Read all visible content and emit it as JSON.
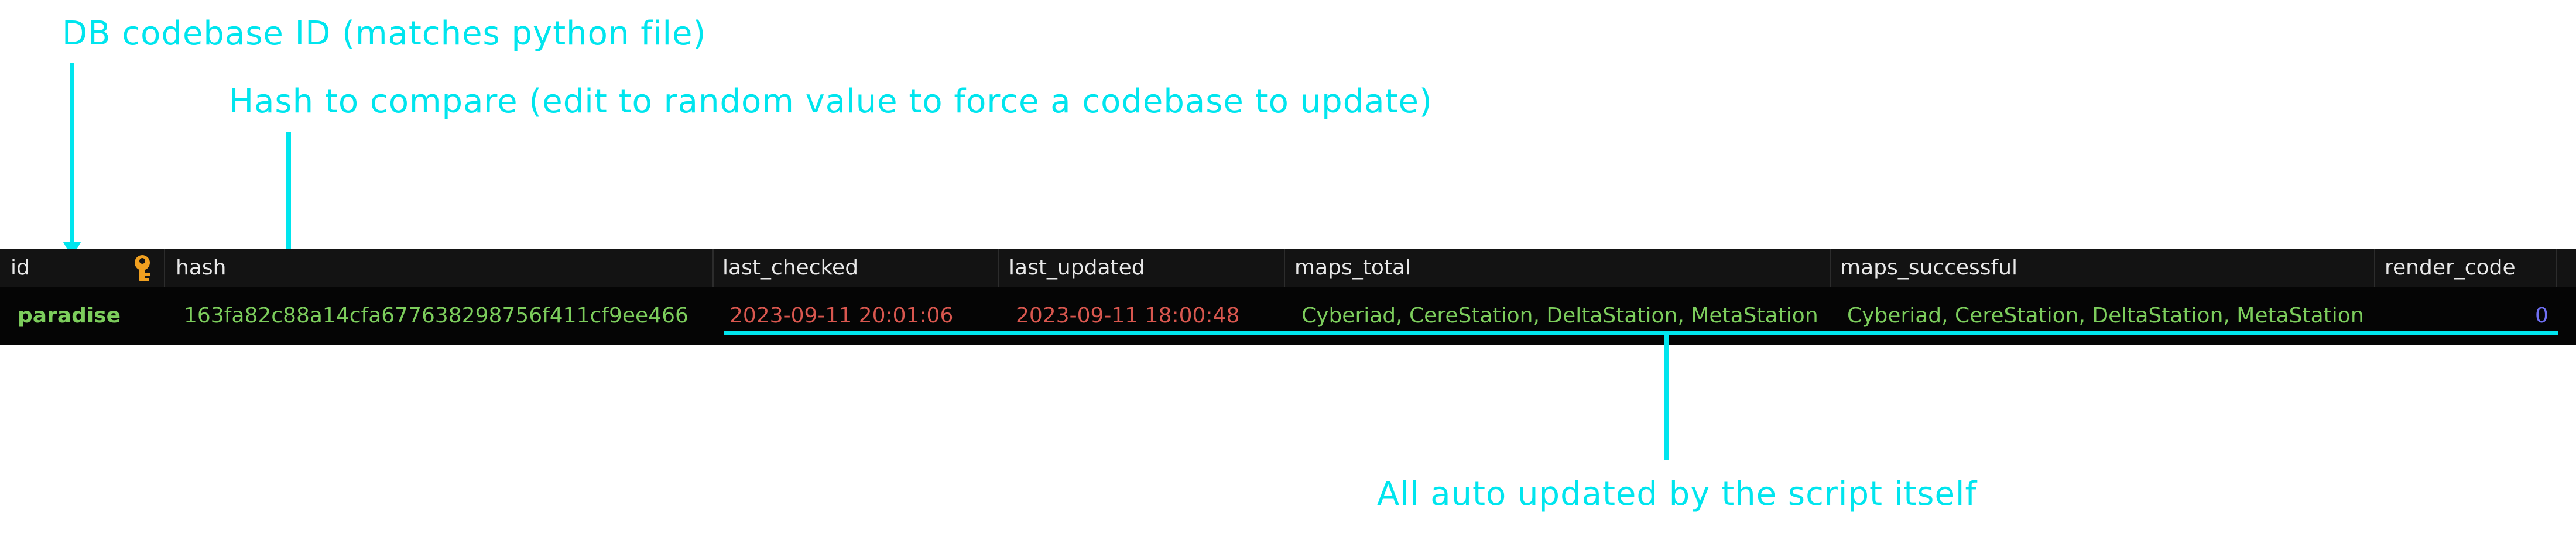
{
  "annotations": {
    "id_note": "DB codebase ID (matches python file)",
    "hash_note": "Hash to compare (edit to random value to force a codebase to update)",
    "auto_note": "All auto updated by the script itself"
  },
  "table": {
    "columns": [
      "id",
      "hash",
      "last_checked",
      "last_updated",
      "maps_total",
      "maps_successful",
      "render_code"
    ],
    "primary_key_icon": "key-icon",
    "rows": [
      {
        "id": "paradise",
        "hash": "163fa82c88a14cfa677638298756f411cf9ee466",
        "last_checked": "2023-09-11 20:01:06",
        "last_updated": "2023-09-11 18:00:48",
        "maps_total": "Cyberiad, CereStation, DeltaStation, MetaStation",
        "maps_successful": "Cyberiad, CereStation, DeltaStation, MetaStation",
        "render_code": "0"
      }
    ]
  },
  "colors": {
    "annotation": "#00e5ee",
    "text_value": "#7ccd5c",
    "datetime_value": "#d9574f",
    "numeric_value": "#6f6ff2",
    "header_bg": "#131313",
    "row_bg": "#050505"
  }
}
